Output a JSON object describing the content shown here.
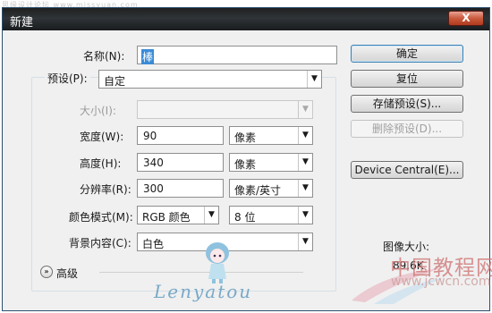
{
  "watermark_top": "思缘设计论坛  www.missyuan.com",
  "dialog": {
    "title": "新建",
    "close_label": "X"
  },
  "fields": {
    "name_label": "名称(N):",
    "name_value": "棒",
    "preset_label": "预设(P):",
    "preset_value": "自定",
    "size_label": "大小(I):",
    "size_value": "",
    "width_label": "宽度(W):",
    "width_value": "90",
    "width_unit": "像素",
    "height_label": "高度(H):",
    "height_value": "340",
    "height_unit": "像素",
    "resolution_label": "分辨率(R):",
    "resolution_value": "300",
    "resolution_unit": "像素/英寸",
    "color_mode_label": "颜色模式(M):",
    "color_mode_value": "RGB 颜色",
    "bit_depth_value": "8 位",
    "background_label": "背景内容(C):",
    "background_value": "白色",
    "advanced_label": "高级"
  },
  "buttons": {
    "ok": "确定",
    "reset": "复位",
    "save_preset": "存储预设(S)...",
    "delete_preset": "删除预设(D)...",
    "device_central": "Device Central(E)..."
  },
  "image_size": {
    "label": "图像大小:",
    "value": "89.6K"
  },
  "branding": {
    "signature": "Lenyatou",
    "site_cn": "中国教程网",
    "site_url": "www.jcwcn.com"
  },
  "colors": {
    "titlebar": "#2a2e31",
    "dialog_bg": "#f0f0f0",
    "default_button_border": "#3c7fb1"
  }
}
